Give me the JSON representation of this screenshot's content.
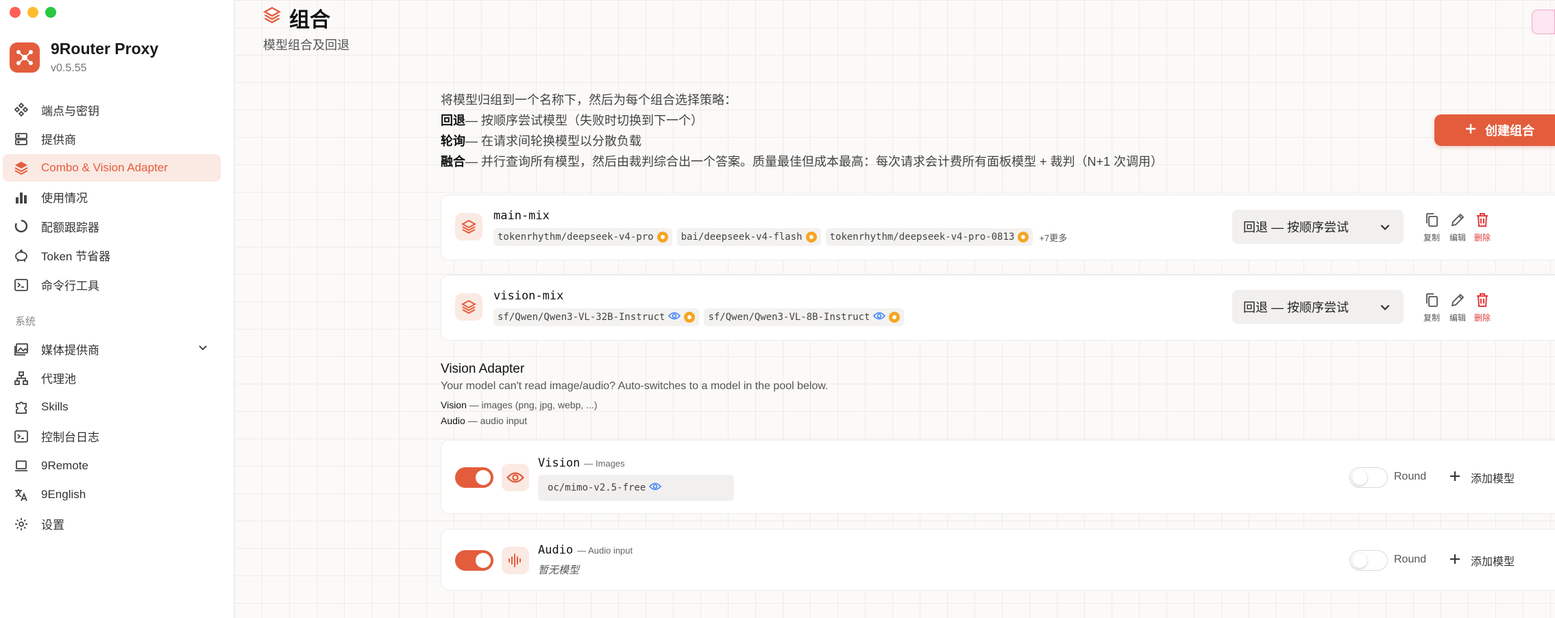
{
  "brand": {
    "name": "9Router Proxy",
    "version": "v0.5.55"
  },
  "sidebar": {
    "items": [
      {
        "label": "端点与密钥",
        "icon": "endpoints-icon"
      },
      {
        "label": "提供商",
        "icon": "providers-icon"
      },
      {
        "label": "Combo & Vision Adapter",
        "icon": "layers-icon",
        "active": true
      },
      {
        "label": "使用情况",
        "icon": "bar-chart-icon"
      },
      {
        "label": "配额跟踪器",
        "icon": "quota-ring-icon"
      },
      {
        "label": "Token 节省器",
        "icon": "piggy-bank-icon"
      },
      {
        "label": "命令行工具",
        "icon": "terminal-icon"
      }
    ],
    "section_label": "系统",
    "system_items": [
      {
        "label": "媒体提供商",
        "icon": "media-icon"
      },
      {
        "label": "代理池",
        "icon": "network-icon"
      },
      {
        "label": "Skills",
        "icon": "puzzle-icon"
      },
      {
        "label": "控制台日志",
        "icon": "console-icon"
      },
      {
        "label": "9Remote",
        "icon": "laptop-icon"
      },
      {
        "label": "9English",
        "icon": "translate-icon"
      },
      {
        "label": "设置",
        "icon": "gear-icon"
      }
    ]
  },
  "header": {
    "title": "组合",
    "subtitle": "模型组合及回退"
  },
  "intro": {
    "line1": "将模型归组到一个名称下，然后为每个组合选择策略：",
    "fallback_term": "回退",
    "fallback_desc": "— 按顺序尝试模型（失败时切换到下一个）",
    "round_term": "轮询",
    "round_desc": "— 在请求间轮换模型以分散负载",
    "fusion_term": "融合",
    "fusion_desc": "— 并行查询所有模型，然后由裁判综合出一个答案。质量最佳但成本最高：每次请求会计费所有面板模型 + 裁判（N+1 次调用）"
  },
  "create_button": "创建组合",
  "combos": [
    {
      "name": "main-mix",
      "models": [
        "tokenrhythm/deepseek-v4-pro",
        "bai/deepseek-v4-flash",
        "tokenrhythm/deepseek-v4-pro-0813"
      ],
      "more": "+7更多",
      "strategy": "回退 — 按顺序尝试"
    },
    {
      "name": "vision-mix",
      "models": [
        "sf/Qwen/Qwen3-VL-32B-Instruct",
        "sf/Qwen/Qwen3-VL-8B-Instruct"
      ],
      "strategy": "回退 — 按顺序尝试"
    }
  ],
  "actions": {
    "copy": "复制",
    "edit": "编辑",
    "delete": "删除"
  },
  "vision_adapter": {
    "title": "Vision Adapter",
    "description": "Your model can't read image/audio? Auto-switches to a model in the pool below.",
    "vision_term": "Vision",
    "vision_desc": " — images (png, jpg, webp, ...)",
    "audio_term": "Audio",
    "audio_desc": " — audio input",
    "vision": {
      "name": "Vision",
      "tag": "— Images",
      "pool_model": "oc/mimo-v2.5-free",
      "round_label": "Round",
      "add_label": "添加模型",
      "enabled": true
    },
    "audio": {
      "name": "Audio",
      "tag": "— Audio input",
      "empty": "暂无模型",
      "round_label": "Round",
      "add_label": "添加模型",
      "enabled": true
    }
  },
  "colors": {
    "accent": "#e35d3d",
    "danger": "#e23b3b",
    "badge": "#f5a623",
    "eye": "#3b82f6"
  }
}
